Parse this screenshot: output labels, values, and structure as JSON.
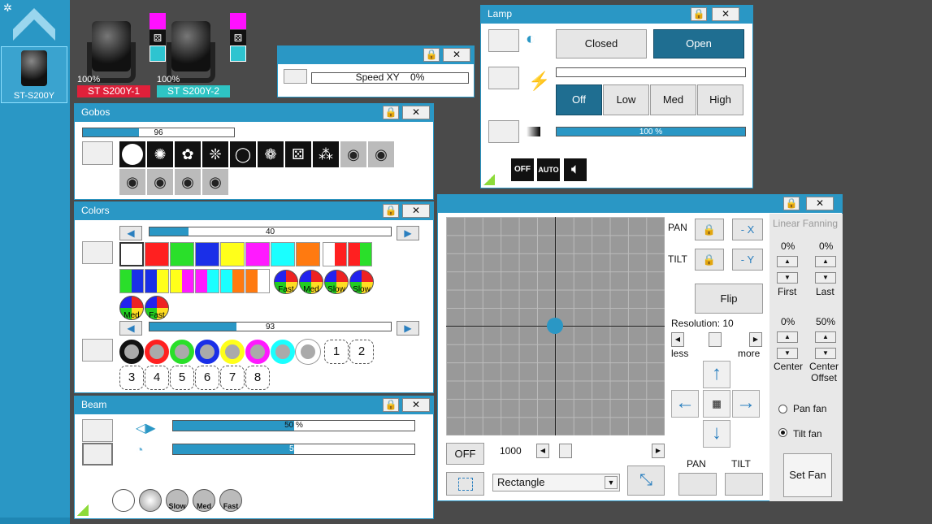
{
  "sidebar": {
    "fixture_label": "ST-S200Y"
  },
  "fixtures": [
    {
      "pct": "100%",
      "name": "ST S200Y-1",
      "color": "#e0203a"
    },
    {
      "pct": "100%",
      "name": "ST S200Y-2",
      "color": "#2ec4c4"
    }
  ],
  "speed": {
    "label": "Speed XY",
    "value": "0%"
  },
  "gobos": {
    "title": "Gobos",
    "slider_value": "96"
  },
  "colors": {
    "title": "Colors",
    "slider1_value": "40",
    "slider2_value": "93",
    "row1": [
      "#ffffff",
      "#ff2020",
      "#2adf2a",
      "#1a2fe8",
      "#ffff1a",
      "#ff1aff",
      "#1affff",
      "#ff7a10"
    ],
    "labels": {
      "fast1": "Fast",
      "med1": "Med",
      "slow1": "Slow",
      "slow2": "Slow",
      "med2": "Med",
      "fast2": "Fast"
    },
    "numbers": [
      "1",
      "2",
      "3",
      "4",
      "5",
      "6",
      "7",
      "8"
    ]
  },
  "beam": {
    "title": "Beam",
    "zoom_value": "50 %",
    "focus_value": "50",
    "slow": "Slow",
    "med": "Med",
    "fast": "Fast"
  },
  "lamp": {
    "title": "Lamp",
    "closed": "Closed",
    "open": "Open",
    "off": "Off",
    "low": "Low",
    "med": "Med",
    "high": "High",
    "dimmer_value": "100 %",
    "icon_off": "OFF",
    "icon_auto": "AUTO"
  },
  "xy": {
    "pan": "PAN",
    "tilt": "TILT",
    "minus_x": "- X",
    "minus_y": "- Y",
    "flip": "Flip",
    "resolution": "Resolution: 10",
    "less": "less",
    "more": "more",
    "off": "OFF",
    "speed_value": "1000",
    "shape": "Rectangle",
    "pan_bottom": "PAN",
    "tilt_bottom": "TILT",
    "linear_fanning": "Linear Fanning",
    "first_pct": "0%",
    "last_pct": "0%",
    "first": "First",
    "last": "Last",
    "center_pct": "0%",
    "offset_pct": "50%",
    "center": "Center",
    "center_offset": "Center\nOffset",
    "pan_fan": "Pan fan",
    "tilt_fan": "Tilt fan",
    "set_fan": "Set Fan"
  }
}
